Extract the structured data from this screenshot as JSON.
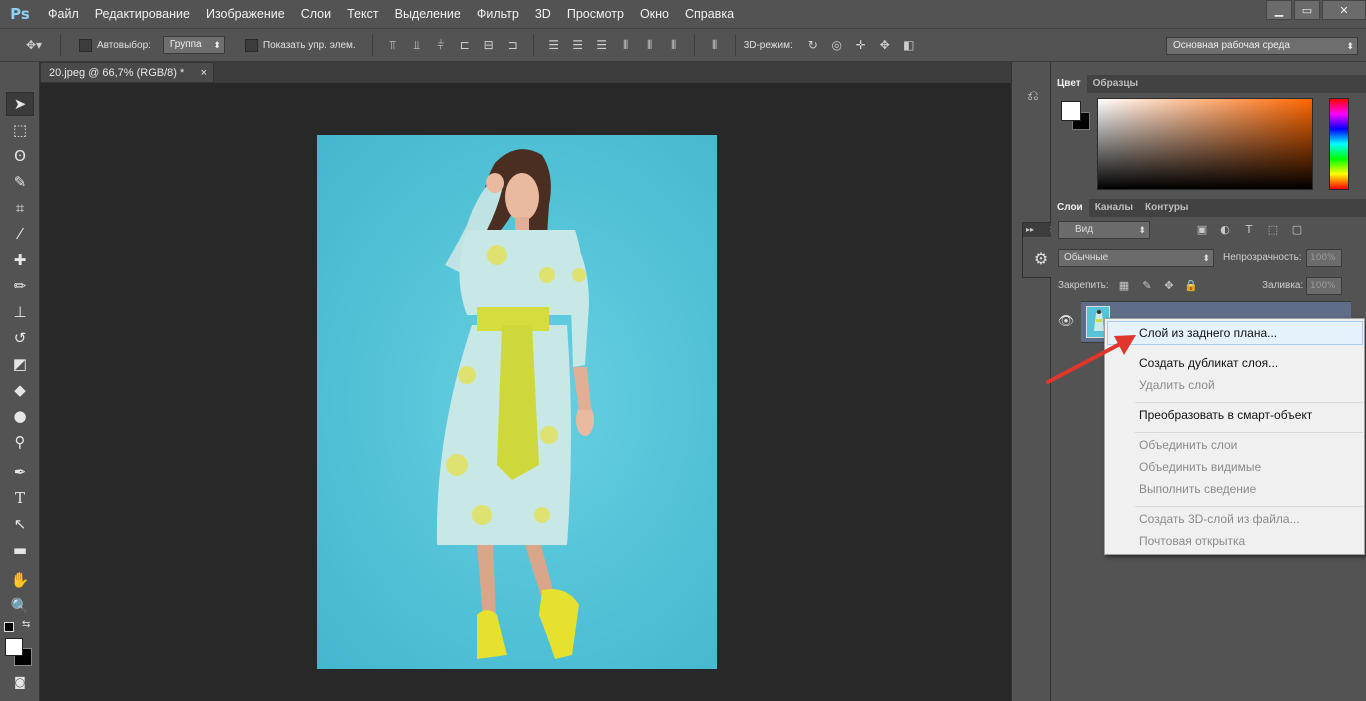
{
  "app": {
    "logo": "Ps",
    "menu": [
      "Файл",
      "Редактирование",
      "Изображение",
      "Слои",
      "Текст",
      "Выделение",
      "Фильтр",
      "3D",
      "Просмотр",
      "Окно",
      "Справка"
    ],
    "window_controls": [
      "▁",
      "▭",
      "✕"
    ]
  },
  "options": {
    "autoselect_label": "Автовыбор:",
    "autoselect_value": "Группа",
    "show_transform_label": "Показать упр. элем.",
    "mode3d_label": "3D-режим:",
    "workspace": "Основная рабочая среда"
  },
  "document": {
    "tab_title": "20.jpeg @ 66,7% (RGB/8) *",
    "close_glyph": "×"
  },
  "color_panel": {
    "tabs": [
      "Цвет",
      "Образцы"
    ],
    "foreground": "#ffffff",
    "background": "#000000"
  },
  "layers_panel": {
    "tabs": [
      "Слои",
      "Каналы",
      "Контуры"
    ],
    "filter_value": "Вид",
    "blend_mode": "Обычные",
    "opacity_label": "Непрозрачность:",
    "opacity_value": "100%",
    "lock_label": "Закрепить:",
    "fill_label": "Заливка:",
    "fill_value": "100%"
  },
  "context_menu": {
    "items": [
      {
        "label": "Слой из заднего плана...",
        "enabled": true
      },
      {
        "label": "Создать дубликат слоя...",
        "enabled": true
      },
      {
        "label": "Удалить слой",
        "enabled": false
      },
      {
        "label": "Преобразовать в смарт-объект",
        "enabled": true
      },
      {
        "label": "Объединить слои",
        "enabled": false
      },
      {
        "label": "Объединить видимые",
        "enabled": false
      },
      {
        "label": "Выполнить сведение",
        "enabled": false
      },
      {
        "label": "Создать 3D-слой из файла...",
        "enabled": false
      },
      {
        "label": "Почтовая открытка",
        "enabled": false
      }
    ]
  },
  "colors": {
    "accent_arrow": "#e0362c",
    "layer_selected": "#5f6d88"
  }
}
